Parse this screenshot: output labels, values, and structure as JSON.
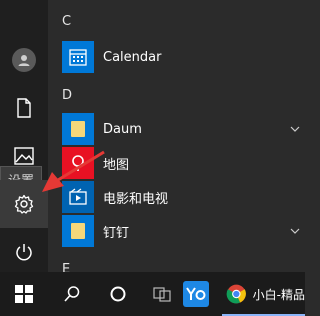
{
  "sidebar": {
    "tooltip": "设置",
    "items": [
      {
        "icon": "user-avatar-icon"
      },
      {
        "icon": "document-icon"
      },
      {
        "icon": "pictures-icon"
      },
      {
        "icon": "gear-icon"
      },
      {
        "icon": "power-icon"
      }
    ]
  },
  "app_list": {
    "groups": [
      {
        "letter": "C",
        "apps": [
          {
            "label": "Calendar",
            "icon": "calendar-icon"
          }
        ]
      },
      {
        "letter": "D",
        "apps": [
          {
            "label": "Daum",
            "icon": "folder-icon",
            "expandable": true
          },
          {
            "label": "地图",
            "icon": "maps-icon"
          },
          {
            "label": "电影和电视",
            "icon": "movies-tv-icon"
          },
          {
            "label": "钉钉",
            "icon": "folder-icon",
            "expandable": true
          }
        ]
      },
      {
        "letter": "E",
        "apps": []
      }
    ]
  },
  "taskbar": {
    "items": [
      {
        "icon": "windows-logo-icon"
      },
      {
        "icon": "search-icon"
      },
      {
        "icon": "cortana-circle-icon"
      },
      {
        "icon": "task-view-icon"
      },
      {
        "icon": "yo-app-icon"
      },
      {
        "icon": "chrome-icon",
        "label": "小白-精品"
      }
    ]
  },
  "colors": {
    "accent": "#0078d7",
    "folder": "#f5d77a",
    "maps": "#e81123",
    "arrow": "#e53935"
  }
}
